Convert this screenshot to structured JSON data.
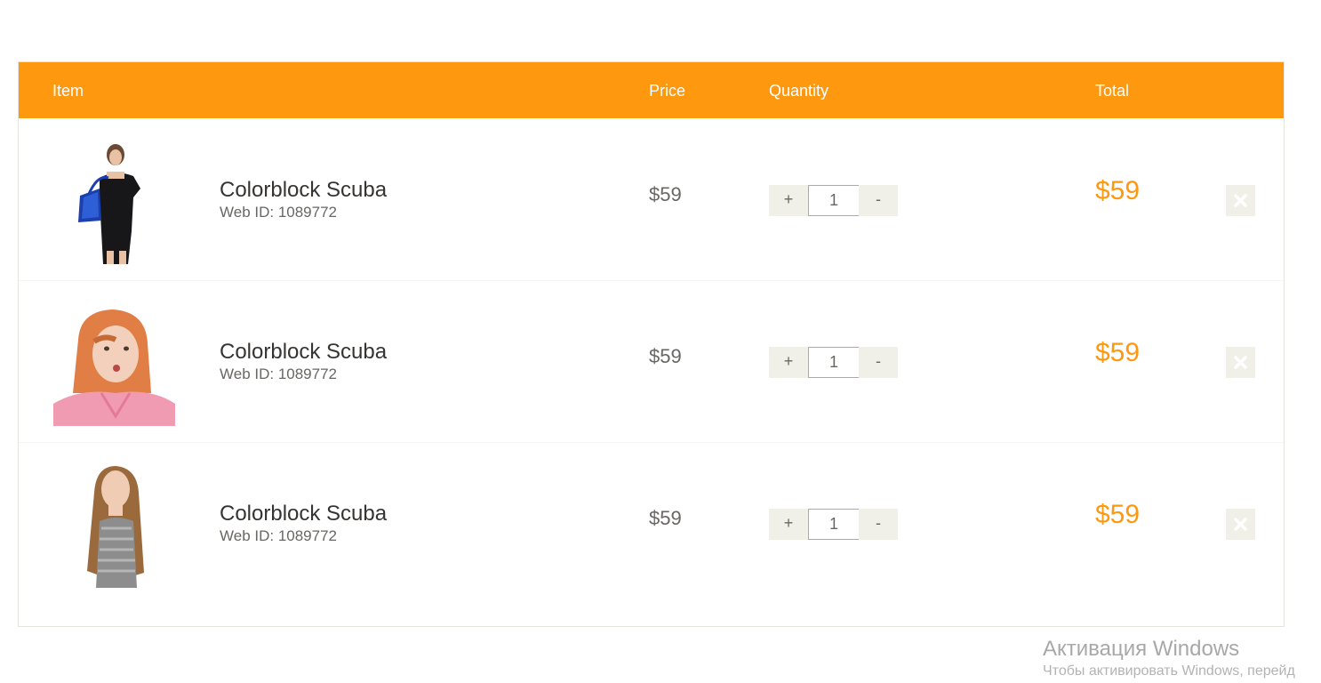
{
  "cart": {
    "headers": {
      "item": "Item",
      "price": "Price",
      "quantity": "Quantity",
      "total": "Total"
    },
    "items": [
      {
        "name": "Colorblock Scuba",
        "web_id": "Web ID: 1089772",
        "price": "$59",
        "quantity": "1",
        "total": "$59",
        "image": "woman-black-dress-shopping-bag"
      },
      {
        "name": "Colorblock Scuba",
        "web_id": "Web ID: 1089772",
        "price": "$59",
        "quantity": "1",
        "total": "$59",
        "image": "redhead-woman-pink-top"
      },
      {
        "name": "Colorblock Scuba",
        "web_id": "Web ID: 1089772",
        "price": "$59",
        "quantity": "1",
        "total": "$59",
        "image": "girl-long-hair-grey-top"
      }
    ],
    "qty_plus_label": "+",
    "qty_minus_label": "-",
    "delete_icon": "close-icon"
  },
  "colors": {
    "accent": "#fe980f",
    "button_bg": "#f0f0e9",
    "border": "#e6e4df"
  },
  "watermark": {
    "title": "Активация Windows",
    "subtitle": "Чтобы активировать Windows, перейд"
  }
}
